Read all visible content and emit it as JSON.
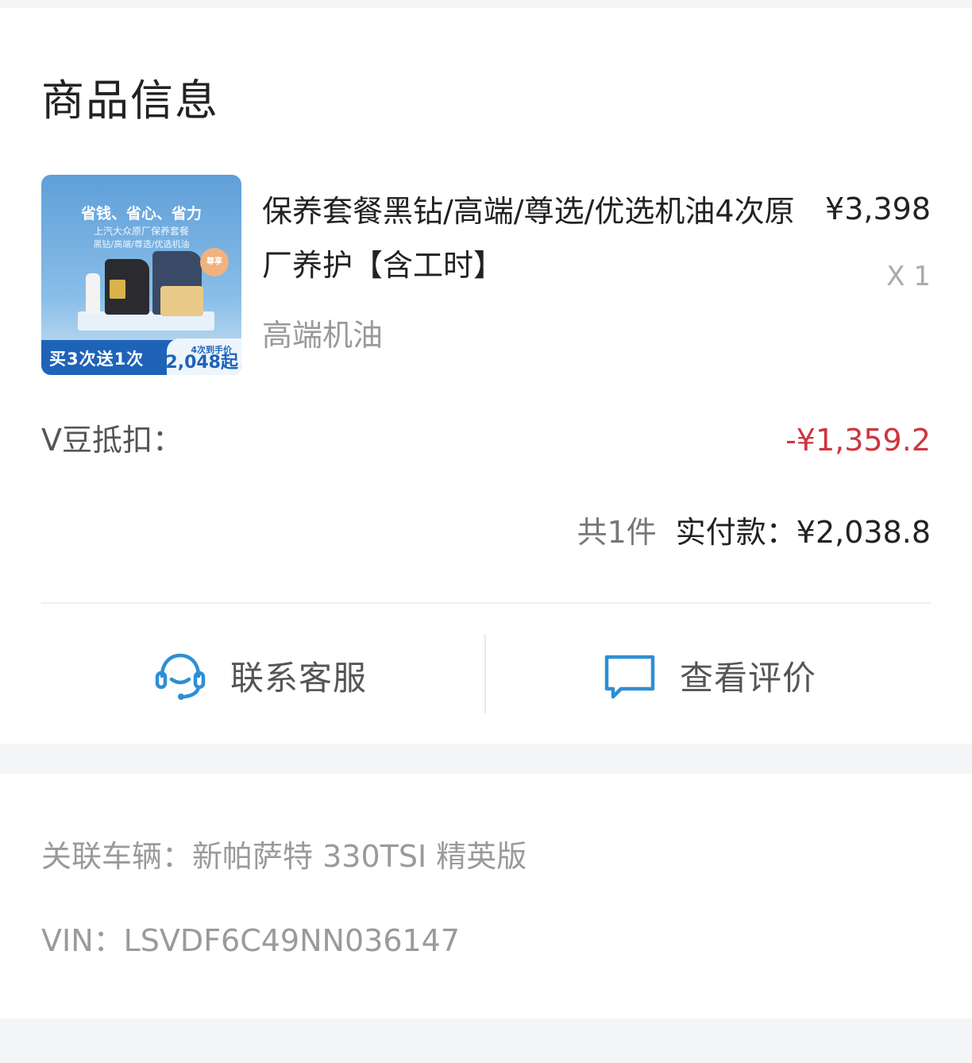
{
  "section": {
    "title": "商品信息"
  },
  "product": {
    "thumbnail": {
      "headline": "省钱、省心、省力",
      "subline1": "上汽大众原厂保养套餐",
      "subline2": "黑钻/高端/尊选/优选机油",
      "seal": "尊享",
      "band_left": "买3次送1次",
      "band_right_top": "4次到手价",
      "band_right_price": "¥2,048起"
    },
    "name": "保养套餐黑钻/高端/尊选/优选机油4次原厂养护【含工时】",
    "price": "¥3,398",
    "quantity": "X 1",
    "spec": "高端机油"
  },
  "vbean": {
    "label": "V豆抵扣：",
    "value": "-¥1,359.2"
  },
  "total": {
    "count": "共1件",
    "paid_label": "实付款：",
    "paid_value": "¥2,038.8"
  },
  "actions": {
    "service": {
      "label": "联系客服",
      "icon": "headset-icon"
    },
    "review": {
      "label": "查看评价",
      "icon": "chat-bubble-icon"
    }
  },
  "vehicle": {
    "label": "关联车辆：",
    "value": "新帕萨特 330TSI 精英版",
    "vin_label": "VIN：",
    "vin_value": "LSVDF6C49NN036147"
  },
  "colors": {
    "accent_blue": "#2d8fd5",
    "discount_red": "#d0343e",
    "muted_text": "#9a9a9a"
  }
}
